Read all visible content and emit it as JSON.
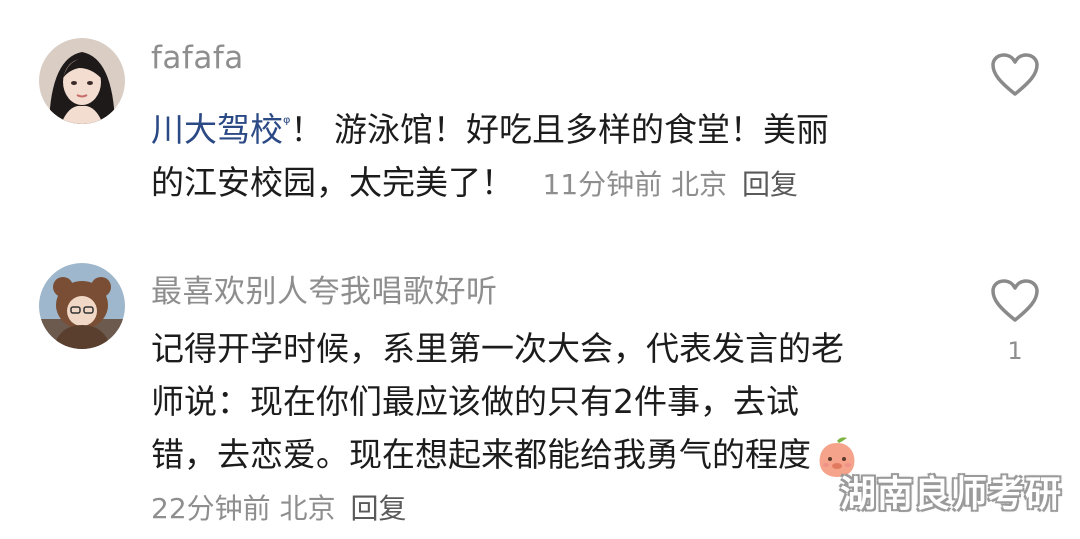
{
  "comments": [
    {
      "username": "fafafa",
      "link_text": "川大驾校",
      "link_marker": "ᵠ",
      "text_after_link": "！ 游泳馆！好吃且多样的食堂！美丽",
      "text_line2": "的江安校园，太完美了！",
      "time": "11分钟前",
      "location": "北京",
      "reply_label": "回复"
    },
    {
      "username": "最喜欢别人夸我唱歌好听",
      "line1": "记得开学时候，系里第一次大会，代表发言的老",
      "line2": "师说：现在你们最应该做的只有2件事，去试",
      "line3": "错，去恋爱。现在想起来都能给我勇气的程度",
      "emoji_icon": "peach-face-emoji",
      "time": "22分钟前",
      "location": "北京",
      "reply_label": "回复",
      "like_count": "1"
    }
  ],
  "watermark": "湖南良师考研",
  "colors": {
    "username": "#8e8e8e",
    "link": "#2b4a85",
    "text": "#1c1c1c",
    "meta": "#8e8e8e"
  }
}
